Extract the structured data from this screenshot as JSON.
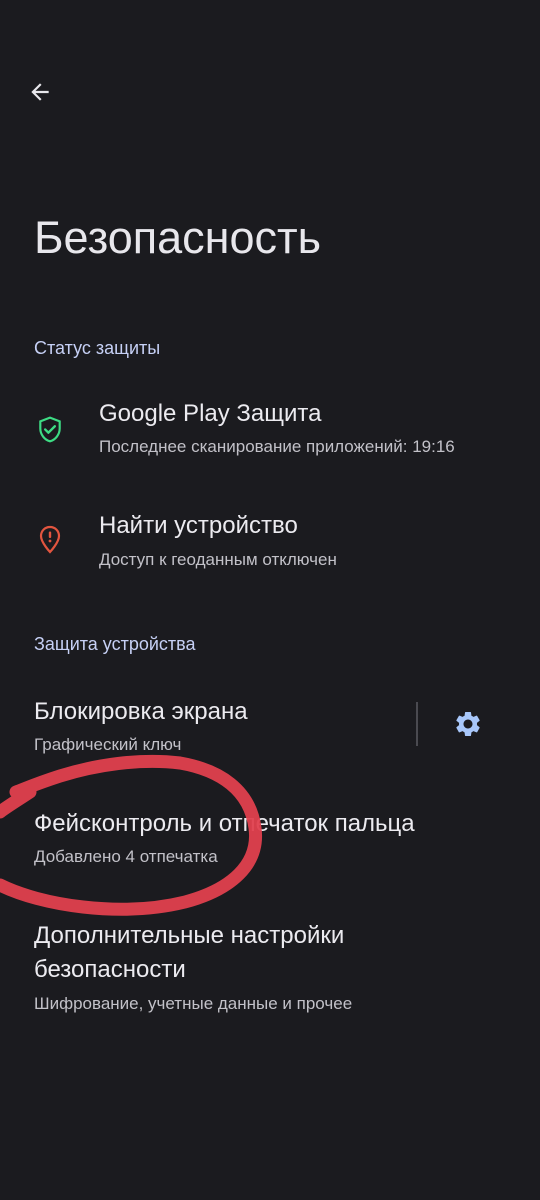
{
  "header": {
    "title": "Безопасность"
  },
  "sections": {
    "status": "Статус защиты",
    "device": "Защита устройства"
  },
  "items": {
    "play_protect": {
      "title": "Google Play Защита",
      "subtitle": "Последнее сканирование приложений: 19:16",
      "icon": "shield-check-icon",
      "icon_color": "#3ddc84"
    },
    "find_device": {
      "title": "Найти устройство",
      "subtitle": "Доступ к геоданным отключен",
      "icon": "location-alert-icon",
      "icon_color": "#e2553f"
    },
    "screen_lock": {
      "title": "Блокировка экрана",
      "subtitle": "Графический ключ",
      "action_icon": "gear-icon"
    },
    "face_fingerprint": {
      "title": "Фейсконтроль и отпечаток пальца",
      "subtitle": "Добавлено 4 отпечатка"
    },
    "advanced": {
      "title_line1": "Дополнительные настройки",
      "title_line2": "безопасности",
      "subtitle": "Шифрование, учетные данные и прочее"
    }
  },
  "colors": {
    "background": "#1b1b1f",
    "section_header": "#c6d0f5",
    "annotation_marker": "#e0404e"
  }
}
